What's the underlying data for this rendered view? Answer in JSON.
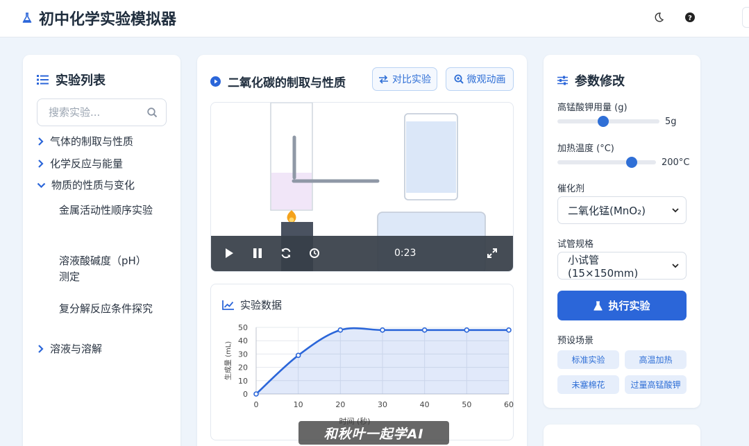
{
  "app": {
    "title": "初中化学实验模拟器"
  },
  "colors": {
    "accent": "#2b66d9",
    "accent_light": "#e6eefb",
    "background": "#eef4fb"
  },
  "sidebar": {
    "title": "实验列表",
    "search_placeholder": "搜索实验...",
    "categories": [
      {
        "label": "气体的制取与性质",
        "expanded": false
      },
      {
        "label": "化学反应与能量",
        "expanded": false
      },
      {
        "label": "物质的性质与变化",
        "expanded": true,
        "children": [
          "金属活动性顺序实验",
          "溶液酸碱度（pH）测定",
          "复分解反应条件探究"
        ]
      },
      {
        "label": "溶液与溶解",
        "expanded": false
      }
    ]
  },
  "experiment": {
    "title": "二氧化碳的制取与性质",
    "compare_label": "对比实验",
    "micro_label": "微观动画",
    "video_time": "0:23"
  },
  "data_panel": {
    "title": "实验数据",
    "chart_data": {
      "type": "line",
      "x": [
        0,
        10,
        20,
        30,
        40,
        50,
        60
      ],
      "y": [
        0,
        29,
        48,
        48,
        48,
        48,
        48
      ],
      "xlabel": "时间 (秒)",
      "ylabel": "生成量 (mL)",
      "xlim": [
        0,
        60
      ],
      "ylim": [
        0,
        50
      ],
      "xticks": [
        "0",
        "10",
        "20",
        "30",
        "40",
        "50",
        "60"
      ],
      "yticks": [
        "0",
        "10",
        "20",
        "30",
        "40",
        "50"
      ],
      "grid": true,
      "line_color": "#2b66d9"
    }
  },
  "params": {
    "title": "参数修改",
    "kmno4": {
      "label": "高锰酸钾用量 (g)",
      "value": "5g",
      "fraction": 0.45
    },
    "temp": {
      "label": "加热温度 (°C)",
      "value": "200°C",
      "fraction": 0.75
    },
    "catalyst": {
      "label": "催化剂",
      "selected": "二氧化锰(MnO₂)"
    },
    "tube": {
      "label": "试管规格",
      "selected": "小试管 (15×150mm)"
    },
    "run_label": "执行实验",
    "presets_title": "预设场景",
    "presets": [
      "标准实验",
      "高温加热",
      "未塞棉花",
      "过量高锰酸钾"
    ]
  },
  "watermark": "和秋叶一起学AI"
}
